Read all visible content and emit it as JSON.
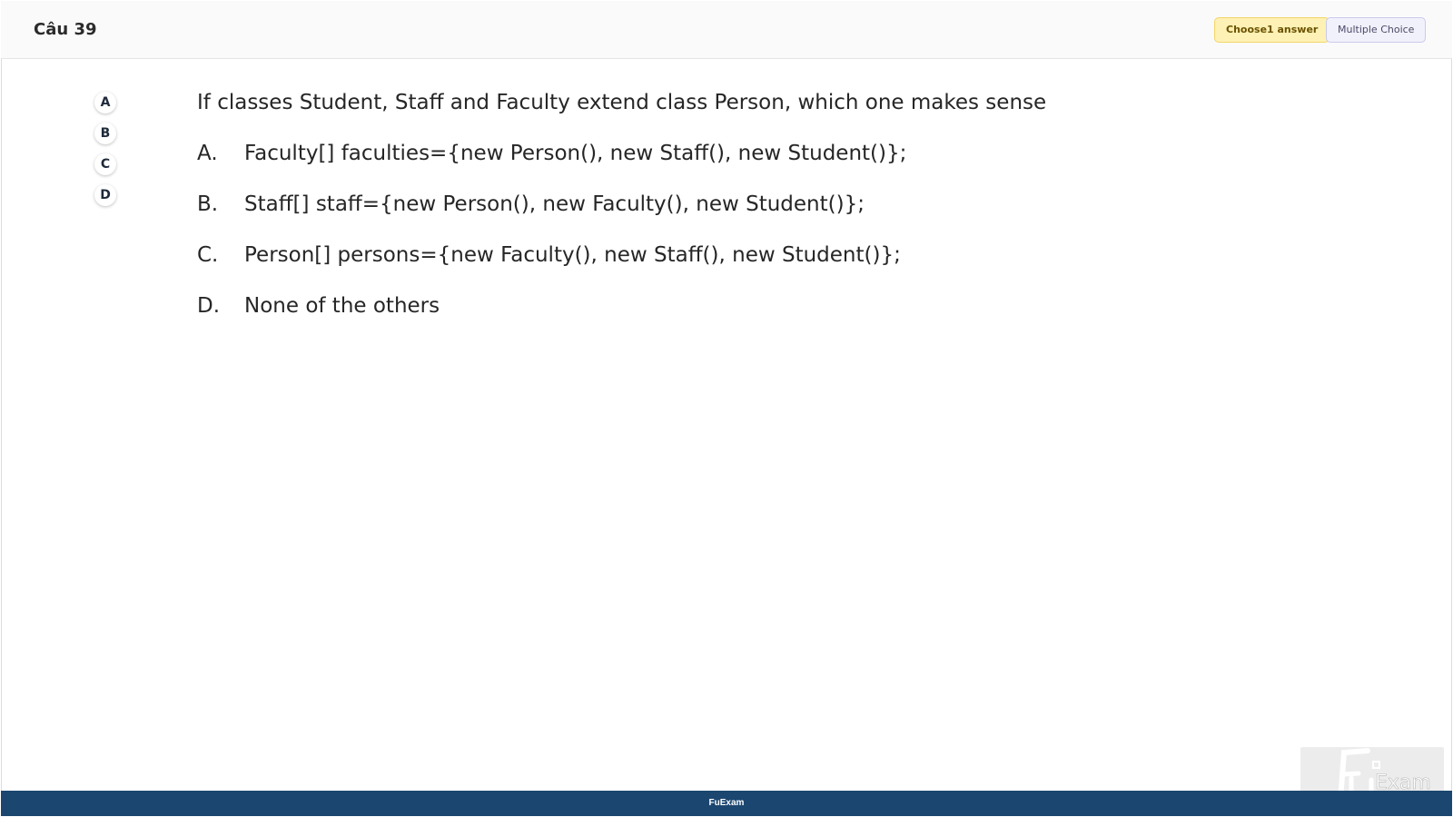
{
  "header": {
    "question_number": "Câu 39",
    "choose_badge": "Choose1 answer",
    "type_badge": "Multiple Choice"
  },
  "answer_picker": {
    "items": [
      {
        "label": "A"
      },
      {
        "label": "B"
      },
      {
        "label": "C"
      },
      {
        "label": "D"
      }
    ]
  },
  "question": {
    "text": "If classes Student, Staff and Faculty extend class Person, which one makes sense",
    "options": [
      {
        "letter": "A.",
        "text": "Faculty[] faculties={new Person(), new Staff(), new Student()};"
      },
      {
        "letter": "B.",
        "text": "Staff[] staff={new Person(), new Faculty(), new Student()};"
      },
      {
        "letter": "C.",
        "text": "Person[] persons={new Faculty(), new Staff(), new Student()};"
      },
      {
        "letter": "D.",
        "text": "None of the others"
      }
    ]
  },
  "footer": {
    "brand": "FuExam"
  },
  "watermark": {
    "text": "Exam",
    "icon": "fu-logo-icon"
  },
  "colors": {
    "footer_bg": "#1b4670",
    "choose_badge_bg": "#fdf1b5",
    "type_badge_bg": "#f1f1fb"
  }
}
